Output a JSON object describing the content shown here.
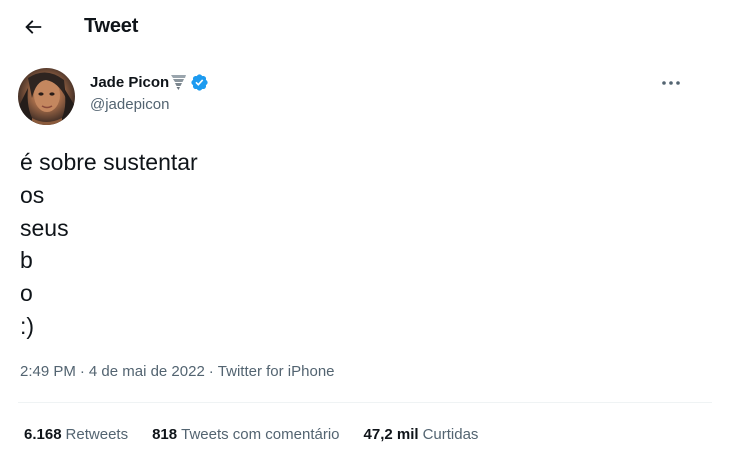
{
  "header": {
    "back_icon": "arrow-left-icon",
    "title": "Tweet"
  },
  "author": {
    "display_name": "Jade Picon",
    "name_emoji_icon": "tornado-icon",
    "verified_icon": "verified-badge-icon",
    "handle": "@jadepicon",
    "avatar_icon": "profile-photo"
  },
  "more_icon": "more-horizontal-icon",
  "tweet": {
    "text": "é sobre sustentar\nos\nseus\nb\no\n:)"
  },
  "meta": {
    "time": "2:49 PM",
    "separator_1": "·",
    "date": "4 de mai de 2022",
    "separator_2": "·",
    "source": "Twitter for iPhone"
  },
  "stats": {
    "retweets": {
      "count": "6.168",
      "label": "Retweets"
    },
    "quotes": {
      "count": "818",
      "label": "Tweets com comentário"
    },
    "likes": {
      "count": "47,2 mil",
      "label": "Curtidas"
    }
  },
  "colors": {
    "text_primary": "#0f1419",
    "text_secondary": "#536471",
    "verified_blue": "#1d9bf0",
    "divider": "#eff3f4"
  }
}
